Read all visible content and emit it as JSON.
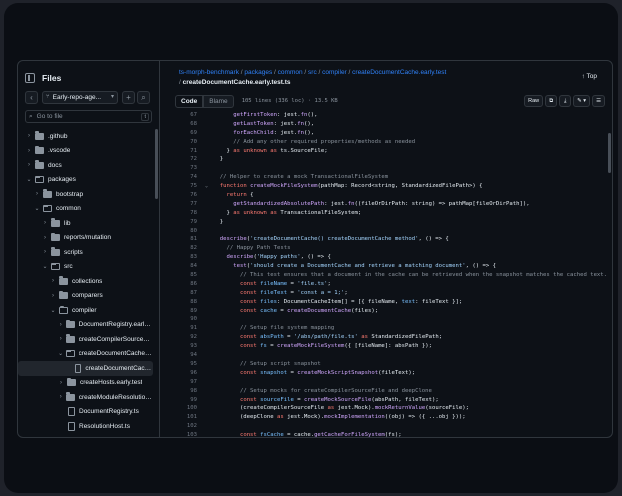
{
  "sidebar": {
    "title": "Files",
    "branch": "Early-repo-age...",
    "goto_placeholder": "Go to file",
    "goto_shortcut": "t",
    "tree": [
      {
        "label": ".github",
        "type": "folder",
        "depth": 0,
        "open": false
      },
      {
        "label": ".vscode",
        "type": "folder",
        "depth": 0,
        "open": false
      },
      {
        "label": "docs",
        "type": "folder",
        "depth": 0,
        "open": false
      },
      {
        "label": "packages",
        "type": "folder",
        "depth": 0,
        "open": true
      },
      {
        "label": "bootstrap",
        "type": "folder",
        "depth": 1,
        "open": false
      },
      {
        "label": "common",
        "type": "folder",
        "depth": 1,
        "open": true
      },
      {
        "label": "lib",
        "type": "folder",
        "depth": 2,
        "open": false
      },
      {
        "label": "reports/mutation",
        "type": "folder",
        "depth": 2,
        "open": false
      },
      {
        "label": "scripts",
        "type": "folder",
        "depth": 2,
        "open": false
      },
      {
        "label": "src",
        "type": "folder",
        "depth": 2,
        "open": true
      },
      {
        "label": "collections",
        "type": "folder",
        "depth": 3,
        "open": false
      },
      {
        "label": "comparers",
        "type": "folder",
        "depth": 3,
        "open": false
      },
      {
        "label": "compiler",
        "type": "folder",
        "depth": 3,
        "open": true
      },
      {
        "label": "DocumentRegistry.early.test",
        "type": "folder",
        "depth": 4,
        "open": false
      },
      {
        "label": "createCompilerSourceFile...",
        "type": "folder",
        "depth": 4,
        "open": false
      },
      {
        "label": "createDocumentCache.ear...",
        "type": "folder",
        "depth": 4,
        "open": true
      },
      {
        "label": "createDocumentCache.e...",
        "type": "file",
        "depth": 5,
        "selected": true
      },
      {
        "label": "createHosts.early.test",
        "type": "folder",
        "depth": 4,
        "open": false
      },
      {
        "label": "createModuleResolutionH...",
        "type": "folder",
        "depth": 4,
        "open": false
      },
      {
        "label": "DocumentRegistry.ts",
        "type": "file",
        "depth": 4
      },
      {
        "label": "ResolutionHost.ts",
        "type": "file",
        "depth": 4
      }
    ]
  },
  "breadcrumb": {
    "parts": [
      "ts-morph-benchmark",
      "packages",
      "common",
      "src",
      "compiler",
      "createDocumentCache.early.test"
    ],
    "file": "createDocumentCache.early.test.ts"
  },
  "top_label": "Top",
  "tabs": {
    "code": "Code",
    "blame": "Blame"
  },
  "file_meta": "105 lines (336 loc) · 13.5 KB",
  "toolbar": {
    "raw": "Raw"
  },
  "code_lines": [
    {
      "n": "67",
      "fold": "",
      "html": "      <span class=\"f\">getFirstToken</span>: jest.<span class=\"f\">fn</span>(),"
    },
    {
      "n": "68",
      "fold": "",
      "html": "      <span class=\"f\">getLastToken</span>: jest.<span class=\"f\">fn</span>(),"
    },
    {
      "n": "69",
      "fold": "",
      "html": "      <span class=\"f\">forEachChild</span>: jest.<span class=\"f\">fn</span>(),"
    },
    {
      "n": "70",
      "fold": "",
      "html": "      <span class=\"cm\">// Add any other required properties/methods as needed</span>"
    },
    {
      "n": "71",
      "fold": "",
      "html": "    } <span class=\"k\">as</span> <span class=\"k\">unknown</span> <span class=\"k\">as</span> ts.SourceFile;"
    },
    {
      "n": "72",
      "fold": "",
      "html": "  }"
    },
    {
      "n": "73",
      "fold": "",
      "html": ""
    },
    {
      "n": "74",
      "fold": "",
      "html": "  <span class=\"cm\">// Helper to create a mock TransactionalFileSystem</span>"
    },
    {
      "n": "75",
      "fold": "v",
      "html": "  <span class=\"k\">function</span> <span class=\"f\">createMockFileSystem</span>(pathMap: Record&lt;string, StandardizedFilePath&gt;) {"
    },
    {
      "n": "76",
      "fold": "",
      "html": "    <span class=\"k\">return</span> {"
    },
    {
      "n": "77",
      "fold": "",
      "html": "      <span class=\"f\">getStandardizedAbsolutePath</span>: jest.<span class=\"f\">fn</span>((fileOrDirPath: string) =&gt; pathMap[fileOrDirPath]),"
    },
    {
      "n": "78",
      "fold": "",
      "html": "    } <span class=\"k\">as</span> <span class=\"k\">unknown</span> <span class=\"k\">as</span> TransactionalFileSystem;"
    },
    {
      "n": "79",
      "fold": "",
      "html": "  }"
    },
    {
      "n": "80",
      "fold": "",
      "html": ""
    },
    {
      "n": "81",
      "fold": "",
      "html": "  <span class=\"f\">describe</span>(<span class=\"s\">'createDocumentCache() createDocumentCache method'</span>, () =&gt; {"
    },
    {
      "n": "82",
      "fold": "",
      "html": "    <span class=\"cm\">// Happy Path Tests</span>"
    },
    {
      "n": "83",
      "fold": "",
      "html": "    <span class=\"f\">describe</span>(<span class=\"s\">'Happy paths'</span>, () =&gt; {"
    },
    {
      "n": "84",
      "fold": "",
      "html": "      <span class=\"f\">test</span>(<span class=\"s\">'should create a DocumentCache and retrieve a matching document'</span>, () =&gt; {"
    },
    {
      "n": "85",
      "fold": "",
      "html": "        <span class=\"cm\">// This test ensures that a document in the cache can be retrieved when the snapshot matches the cached text.</span>"
    },
    {
      "n": "86",
      "fold": "",
      "html": "        <span class=\"k\">const</span> <span class=\"c\">fileName</span> = <span class=\"s\">'file.ts'</span>;"
    },
    {
      "n": "87",
      "fold": "",
      "html": "        <span class=\"k\">const</span> <span class=\"c\">fileText</span> = <span class=\"s\">'const a = 1;'</span>;"
    },
    {
      "n": "88",
      "fold": "",
      "html": "        <span class=\"k\">const</span> <span class=\"c\">files</span>: DocumentCacheItem[] = [{ fileName, <span class=\"c\">text</span>: fileText }];"
    },
    {
      "n": "89",
      "fold": "",
      "html": "        <span class=\"k\">const</span> <span class=\"c\">cache</span> = <span class=\"f\">createDocumentCache</span>(files);"
    },
    {
      "n": "90",
      "fold": "",
      "html": ""
    },
    {
      "n": "91",
      "fold": "",
      "html": "        <span class=\"cm\">// Setup file system mapping</span>"
    },
    {
      "n": "92",
      "fold": "",
      "html": "        <span class=\"k\">const</span> <span class=\"c\">absPath</span> = <span class=\"s\">'/abs/path/file.ts'</span> <span class=\"k\">as</span> StandardizedFilePath;"
    },
    {
      "n": "93",
      "fold": "",
      "html": "        <span class=\"k\">const</span> <span class=\"c\">fs</span> = <span class=\"f\">createMockFileSystem</span>({ [fileName]: absPath });"
    },
    {
      "n": "94",
      "fold": "",
      "html": ""
    },
    {
      "n": "95",
      "fold": "",
      "html": "        <span class=\"cm\">// Setup script snapshot</span>"
    },
    {
      "n": "96",
      "fold": "",
      "html": "        <span class=\"k\">const</span> <span class=\"c\">snapshot</span> = <span class=\"f\">createMockScriptSnapshot</span>(fileText);"
    },
    {
      "n": "97",
      "fold": "",
      "html": ""
    },
    {
      "n": "98",
      "fold": "",
      "html": "        <span class=\"cm\">// Setup mocks for createCompilerSourceFile and deepClone</span>"
    },
    {
      "n": "99",
      "fold": "",
      "html": "        <span class=\"k\">const</span> <span class=\"c\">sourceFile</span> = <span class=\"f\">createMockSourceFile</span>(absPath, fileText);"
    },
    {
      "n": "100",
      "fold": "",
      "html": "        (createCompilerSourceFile <span class=\"k\">as</span> jest.Mock).<span class=\"f\">mockReturnValue</span>(sourceFile);"
    },
    {
      "n": "101",
      "fold": "",
      "html": "        (deepClone <span class=\"k\">as</span> jest.Mock).<span class=\"f\">mockImplementation</span>((obj) =&gt; ({ ...obj }));"
    },
    {
      "n": "102",
      "fold": "",
      "html": ""
    },
    {
      "n": "103",
      "fold": "",
      "html": "        <span class=\"k\">const</span> <span class=\"c\">fsCache</span> = cache.<span class=\"f\">getCacheForFileSystem</span>(fs);"
    }
  ]
}
